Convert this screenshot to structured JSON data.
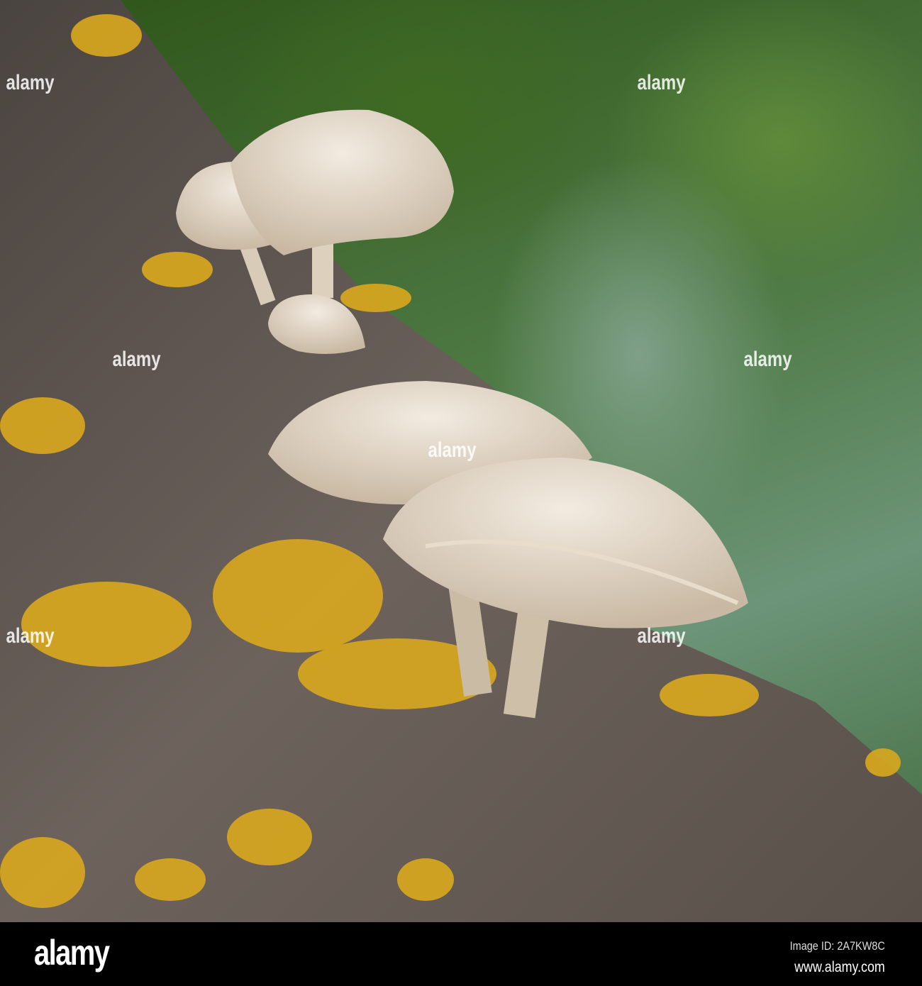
{
  "watermark": {
    "text": "alamy"
  },
  "footer": {
    "logo": "alamy",
    "image_id": "Image ID: 2A7KW8C",
    "url": "www.alamy.com"
  }
}
